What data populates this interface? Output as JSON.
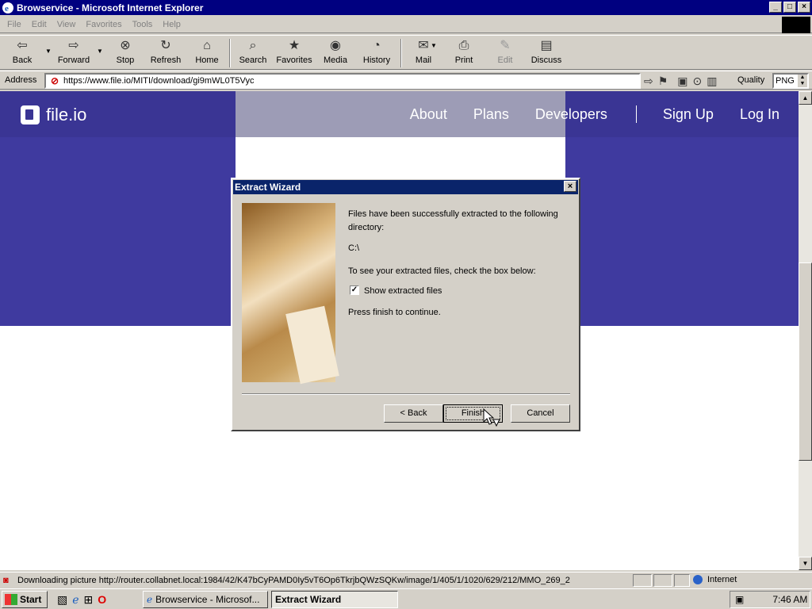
{
  "window": {
    "title": "Browservice - Microsoft Internet Explorer",
    "buttons": [
      "_",
      "□",
      "×"
    ]
  },
  "menubar": [
    "File",
    "Edit",
    "View",
    "Favorites",
    "Tools",
    "Help"
  ],
  "toolbar": {
    "back": "Back",
    "forward": "Forward",
    "stop": "Stop",
    "refresh": "Refresh",
    "home": "Home",
    "search": "Search",
    "favorites": "Favorites",
    "media": "Media",
    "history": "History",
    "mail": "Mail",
    "print": "Print",
    "edit": "Edit",
    "discuss": "Discuss"
  },
  "address": {
    "label": "Address",
    "url": "https://www.file.io/MITI/download/gi9mWL0T5Vyc",
    "quality_label": "Quality",
    "quality_value": "PNG"
  },
  "site": {
    "logo_text": "file.io",
    "nav": [
      "About",
      "Plans",
      "Developers",
      "Sign Up",
      "Log In"
    ]
  },
  "dialog": {
    "title": "Extract Wizard",
    "message": "Files have been successfully extracted to the following directory:",
    "directory": "C:\\",
    "hint": "To see your extracted files, check the box below:",
    "checkbox_label": "Show extracted files",
    "checkbox_checked": true,
    "continue_text": "Press finish to continue.",
    "back_label": "< Back",
    "finish_label": "Finish",
    "cancel_label": "Cancel"
  },
  "status": {
    "text": "Downloading picture http://router.collabnet.local:1984/42/K47bCyPAMD0Iy5vT6Op6TkrjbQWzSQKw/image/1/405/1/1020/629/212/MMO_269_2",
    "zone": "Internet"
  },
  "taskbar": {
    "start": "Start",
    "tasks": [
      "Browservice - Microsof...",
      "Extract Wizard"
    ],
    "clock": "7:46 AM"
  }
}
